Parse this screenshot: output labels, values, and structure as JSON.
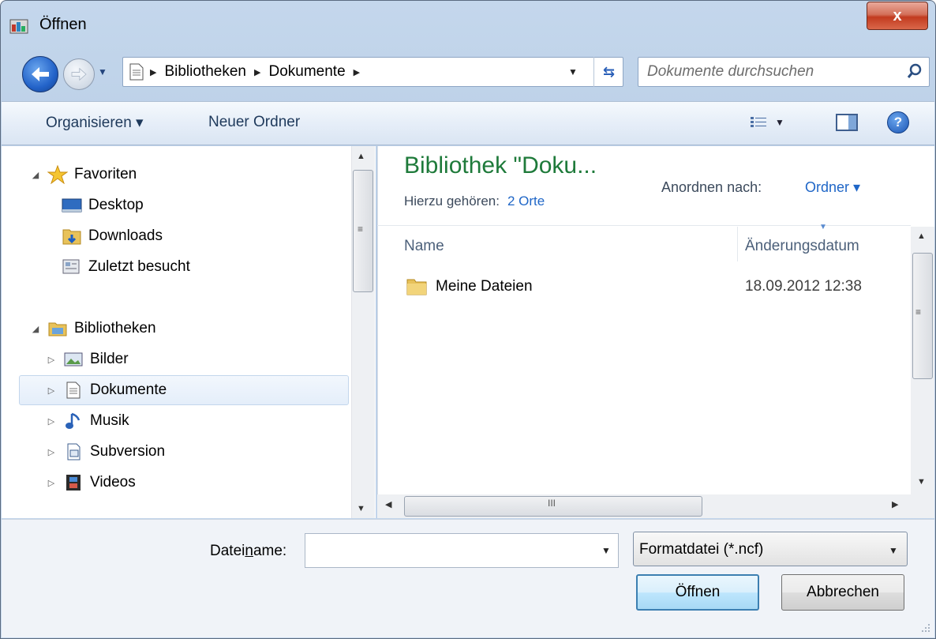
{
  "window": {
    "title": "Öffnen",
    "close_label": "x"
  },
  "address_bar": {
    "crumbs": [
      "Bibliotheken",
      "Dokumente"
    ],
    "search_placeholder": "Dokumente durchsuchen"
  },
  "toolbar": {
    "organize_label": "Organisieren ▾",
    "new_folder_label": "Neuer Ordner",
    "help_label": "?"
  },
  "nav": {
    "favorites": {
      "label": "Favoriten",
      "items": [
        "Desktop",
        "Downloads",
        "Zuletzt besucht"
      ]
    },
    "libraries": {
      "label": "Bibliotheken",
      "items": [
        "Bilder",
        "Dokumente",
        "Musik",
        "Subversion",
        "Videos"
      ]
    },
    "selected": "Dokumente"
  },
  "content": {
    "library_title": "Bibliothek \"Doku...",
    "includes_label": "Hierzu gehören:",
    "includes_link": "2 Orte",
    "arrange_label": "Anordnen nach:",
    "arrange_value": "Ordner ▾",
    "columns": [
      "Name",
      "Änderungsdatum"
    ],
    "rows": [
      {
        "name": "Meine Dateien",
        "date": "18.09.2012 12:38"
      }
    ],
    "scroll_grip": "≡",
    "hscroll_grip": "III"
  },
  "bottom": {
    "filename_label_pre": "Datei",
    "filename_label_ul": "n",
    "filename_label_post": "ame:",
    "filename_value": "",
    "filetype_value": "Formatdatei (*.ncf)",
    "open_label": "Öffnen",
    "cancel_label": "Abbrechen"
  },
  "colors": {
    "accent_green": "#1e7a3a",
    "link_blue": "#1f66c7",
    "close_red": "#c23b1f"
  }
}
